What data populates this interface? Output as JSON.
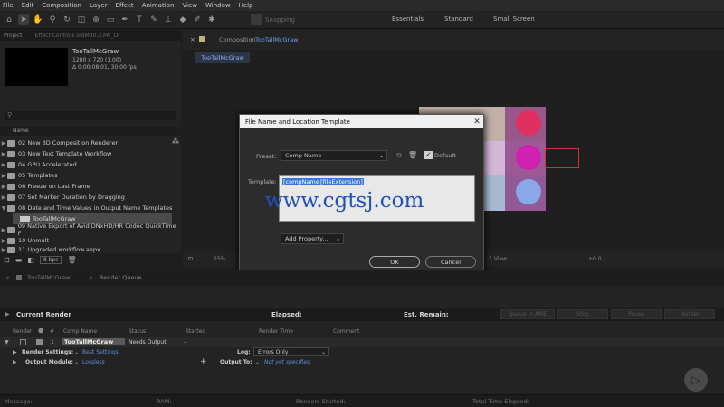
{
  "menu": [
    "File",
    "Edit",
    "Composition",
    "Layer",
    "Effect",
    "Animation",
    "View",
    "Window",
    "Help"
  ],
  "toolbar": {
    "snapping_label": "Snapping",
    "workspaces": [
      "Essentials",
      "Standard",
      "Small Screen"
    ]
  },
  "project": {
    "tab": "Project",
    "effect_controls_tab": "Effect Controls oldMd0.3.MF_DI",
    "selected_name": "TooTallMcGraw",
    "resolution": "1280 x 720 (1.00)",
    "duration": "Δ 0:00:08:01, 30.00 fps",
    "column_name": "Name",
    "items": [
      "02 New 3D Composition Renderer",
      "03 New Text Template Workflow",
      "04 GPU Accelerated",
      "05 Templates",
      "06 Freeze on Last Frame",
      "07 Set Marker Duration by Dragging",
      "08 Date and Time Values in Output Name Templates",
      "TooTallMcGraw",
      "09 Native Export of Avid DNxHD/HR Codec QuickTime F",
      "10 Unmult",
      "11 Upgraded workflow.aepx"
    ],
    "bpc": "8 bpc"
  },
  "composition": {
    "tab_label": "Composition",
    "tab_comp": "TooTallMcGraw",
    "subtab": "TooTallMcGraw",
    "zoom": "25%",
    "view": "1 View",
    "offset": "+0.0"
  },
  "dialog": {
    "title": "File Name and Location Template",
    "preset_label": "Preset:",
    "preset_value": "Comp Name",
    "default_label": "Default",
    "template_label": "Template:",
    "template_token1": "[compName]",
    "template_token2": "[fileExtension]",
    "watermark": "www.cgtsj.com",
    "add_property": "Add Property...",
    "ok": "OK",
    "cancel": "Cancel"
  },
  "bottom_tabs": {
    "timeline": "TooTallMcGraw",
    "render_queue": "Render Queue"
  },
  "render_queue": {
    "current_render": "Current Render",
    "elapsed": "Elapsed:",
    "est_remain": "Est. Remain:",
    "queue_ame": "Queue in AME",
    "stop": "Stop",
    "pause": "Pause",
    "render": "Render",
    "columns": [
      "Render",
      "#",
      "Comp Name",
      "Status",
      "Started",
      "Render Time",
      "Comment"
    ],
    "row": {
      "number": "1",
      "comp_name": "TooTallMcGraw",
      "status": "Needs Output",
      "started": "-"
    },
    "render_settings_label": "Render Settings:",
    "render_settings_value": "Best Settings",
    "log_label": "Log:",
    "log_value": "Errors Only",
    "output_module_label": "Output Module:",
    "output_module_value": "Lossless",
    "output_to_label": "Output To:",
    "output_to_value": "Not yet specified"
  },
  "statusbar": {
    "message": "Message:",
    "ram": "RAM:",
    "renders_started": "Renders Started:",
    "total_time": "Total Time Elapsed:"
  }
}
